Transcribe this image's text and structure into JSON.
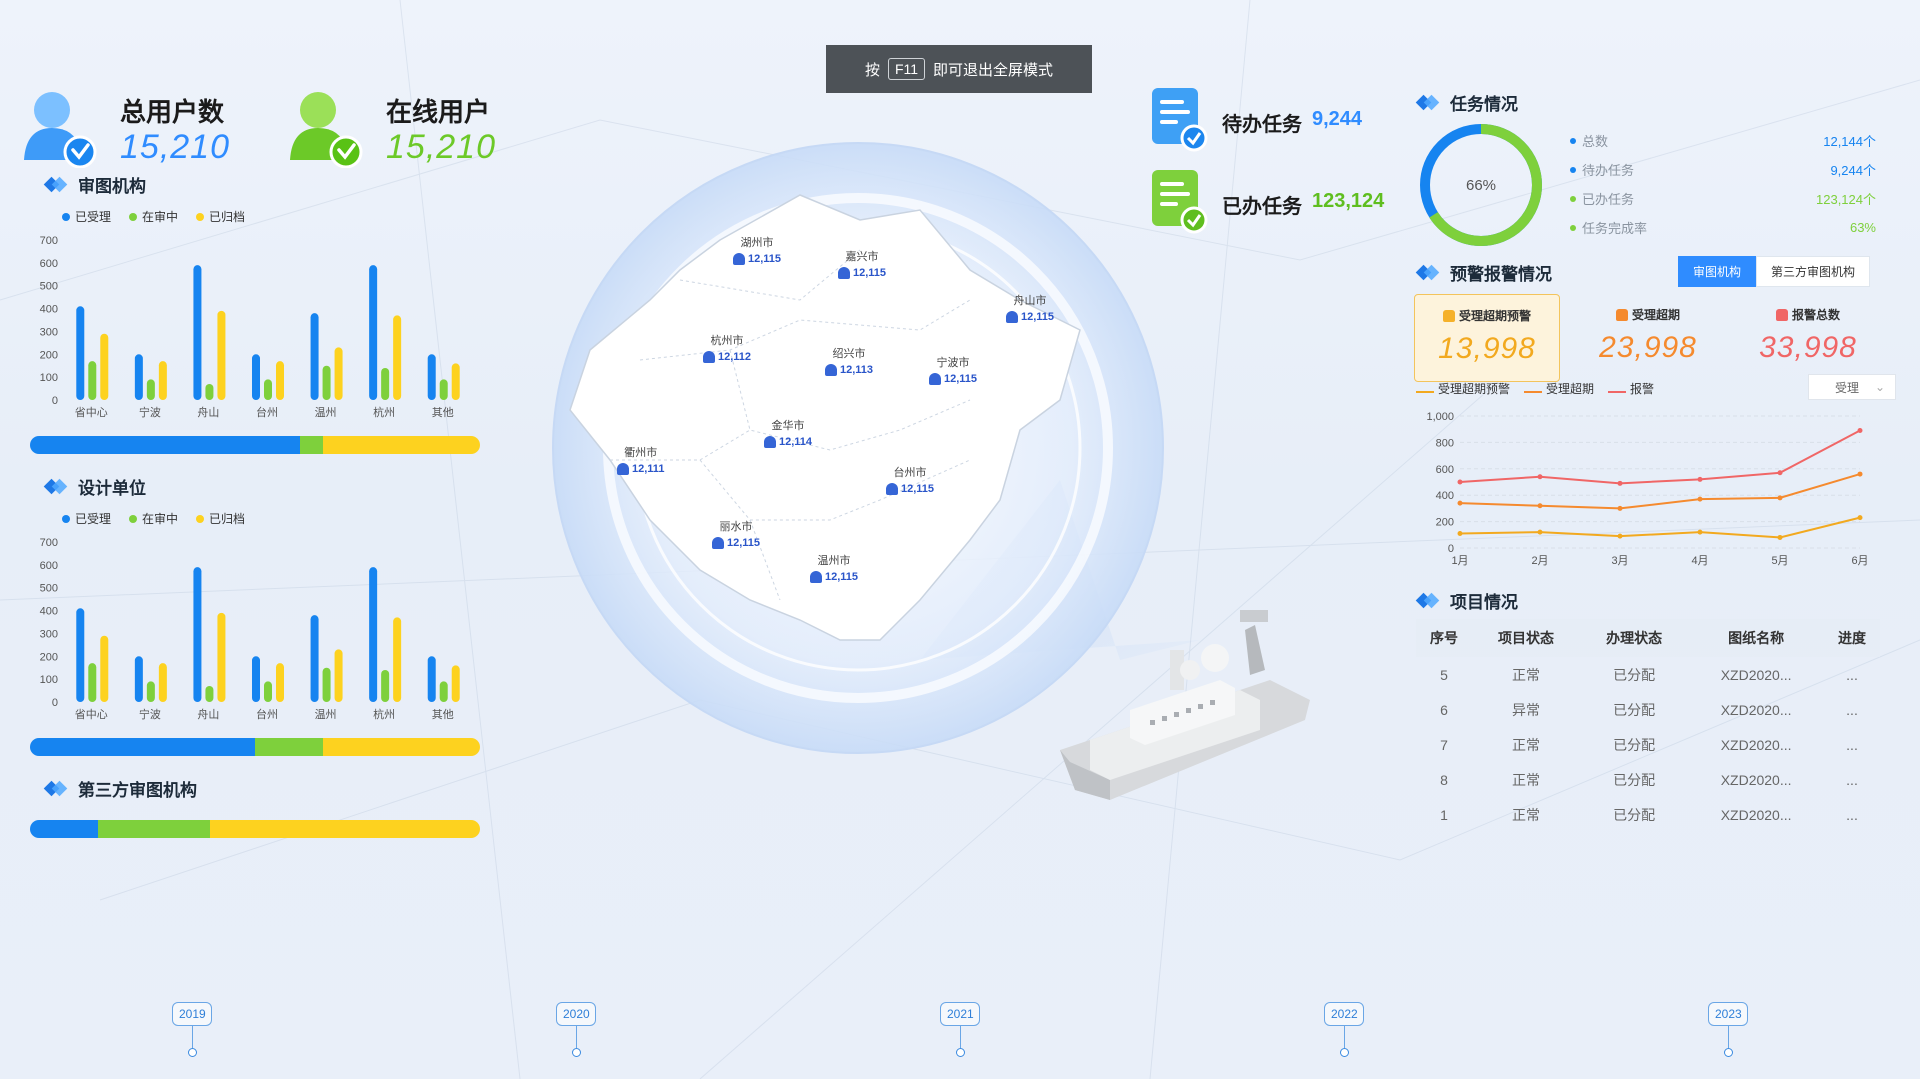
{
  "colors": {
    "blue": "#1684f0",
    "green": "#7ed03c",
    "yellow": "#fdd21f",
    "orange": "#f49a3b",
    "red": "#f06666",
    "primary": "#2f8cff"
  },
  "kpi": {
    "total_users": {
      "label": "总用户数",
      "value": "15,210"
    },
    "online_users": {
      "label": "在线用户",
      "value": "15,210"
    }
  },
  "fullscreen_hint": {
    "prefix": "按",
    "key": "F11",
    "suffix": "即可退出全屏模式"
  },
  "review_org": {
    "title": "审图机构",
    "legend": [
      "已受理",
      "在审中",
      "已归档"
    ],
    "y_ticks": [
      "700",
      "600",
      "500",
      "400",
      "300",
      "200",
      "100",
      "0"
    ],
    "progress": [
      0.6,
      0.05,
      0.35
    ]
  },
  "design_unit": {
    "title": "设计单位",
    "legend": [
      "已受理",
      "在审中",
      "已归档"
    ],
    "y_ticks": [
      "700",
      "600",
      "500",
      "400",
      "300",
      "200",
      "100",
      "0"
    ],
    "progress": [
      0.5,
      0.15,
      0.35
    ]
  },
  "third_party": {
    "title": "第三方审图机构",
    "progress": [
      0.15,
      0.25,
      0.6
    ]
  },
  "chart_data": [
    {
      "type": "bar",
      "title": "审图机构",
      "categories": [
        "省中心",
        "宁波",
        "舟山",
        "台州",
        "温州",
        "杭州",
        "其他"
      ],
      "ylim": [
        0,
        700
      ],
      "series": [
        {
          "name": "已受理",
          "values": [
            410,
            200,
            590,
            200,
            380,
            590,
            200
          ]
        },
        {
          "name": "在审中",
          "values": [
            170,
            90,
            70,
            90,
            150,
            140,
            90
          ]
        },
        {
          "name": "已归档",
          "values": [
            290,
            170,
            390,
            170,
            230,
            370,
            160
          ]
        }
      ]
    },
    {
      "type": "bar",
      "title": "设计单位",
      "categories": [
        "省中心",
        "宁波",
        "舟山",
        "台州",
        "温州",
        "杭州",
        "其他"
      ],
      "ylim": [
        0,
        700
      ],
      "series": [
        {
          "name": "已受理",
          "values": [
            410,
            200,
            590,
            200,
            380,
            590,
            200
          ]
        },
        {
          "name": "在审中",
          "values": [
            170,
            90,
            70,
            90,
            150,
            140,
            90
          ]
        },
        {
          "name": "已归档",
          "values": [
            290,
            170,
            390,
            170,
            230,
            370,
            160
          ]
        }
      ]
    },
    {
      "type": "line",
      "title": "",
      "categories": [
        "1月",
        "2月",
        "3月",
        "4月",
        "5月",
        "6月"
      ],
      "ylim": [
        0,
        1000
      ],
      "y_ticks": [
        "1,000",
        "800",
        "600",
        "400",
        "200",
        "0"
      ],
      "series": [
        {
          "name": "受理超期预警",
          "values": [
            110,
            120,
            90,
            120,
            80,
            230
          ]
        },
        {
          "name": "受理超期",
          "values": [
            340,
            320,
            300,
            370,
            380,
            560
          ]
        },
        {
          "name": "报警",
          "values": [
            500,
            540,
            490,
            520,
            570,
            890
          ]
        }
      ]
    },
    {
      "type": "pie",
      "title": "",
      "values": [
        66,
        34
      ],
      "center_label": "66%"
    }
  ],
  "map": {
    "cities": [
      {
        "name": "湖州市",
        "value": "12,115"
      },
      {
        "name": "嘉兴市",
        "value": "12,115"
      },
      {
        "name": "舟山市",
        "value": "12,115"
      },
      {
        "name": "杭州市",
        "value": "12,112"
      },
      {
        "name": "绍兴市",
        "value": "12,113"
      },
      {
        "name": "宁波市",
        "value": "12,115"
      },
      {
        "name": "金华市",
        "value": "12,114"
      },
      {
        "name": "衢州市",
        "value": "12,111"
      },
      {
        "name": "台州市",
        "value": "12,115"
      },
      {
        "name": "丽水市",
        "value": "12,115"
      },
      {
        "name": "温州市",
        "value": "12,115"
      }
    ]
  },
  "tasks": {
    "pending": {
      "label": "待办任务",
      "value": "9,244"
    },
    "done": {
      "label": "已办任务",
      "value": "123,124"
    }
  },
  "task_status": {
    "title": "任务情况",
    "items": [
      {
        "label": "总数",
        "value": "12,144个"
      },
      {
        "label": "待办任务",
        "value": "9,244个"
      },
      {
        "label": "已办任务",
        "value": "123,124个"
      },
      {
        "label": "任务完成率",
        "value": "63%"
      }
    ]
  },
  "alarm": {
    "title": "预警报警情况",
    "tabs": [
      "审图机构",
      "第三方审图机构"
    ],
    "boxes": [
      {
        "label": "受理超期预警",
        "value": "13,998"
      },
      {
        "label": "受理超期",
        "value": "23,998"
      },
      {
        "label": "报警总数",
        "value": "33,998"
      }
    ],
    "legend": [
      "受理超期预警",
      "受理超期",
      "报警"
    ],
    "select_value": "受理"
  },
  "project": {
    "title": "项目情况",
    "headers": [
      "序号",
      "项目状态",
      "办理状态",
      "图纸名称",
      "进度"
    ],
    "rows": [
      [
        "5",
        "正常",
        "已分配",
        "XZD2020...",
        "..."
      ],
      [
        "6",
        "异常",
        "已分配",
        "XZD2020...",
        "..."
      ],
      [
        "7",
        "正常",
        "已分配",
        "XZD2020...",
        "..."
      ],
      [
        "8",
        "正常",
        "已分配",
        "XZD2020...",
        "..."
      ],
      [
        "1",
        "正常",
        "已分配",
        "XZD2020...",
        "..."
      ]
    ]
  },
  "timeline": [
    "2019",
    "2020",
    "2021",
    "2022",
    "2023"
  ]
}
